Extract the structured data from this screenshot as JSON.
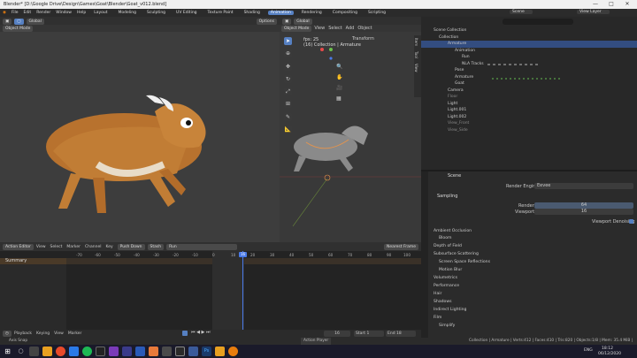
{
  "window": {
    "title": "Blender* [D:\\Google Drive\\Design\\Games\\Goat\\Blender\\Goat_v012.blend]"
  },
  "menu": [
    "File",
    "Edit",
    "Render",
    "Window",
    "Help"
  ],
  "workspaces": [
    "Layout",
    "Modeling",
    "Sculpting",
    "UV Editing",
    "Texture Paint",
    "Shading",
    "Animation",
    "Rendering",
    "Compositing",
    "Scripting"
  ],
  "active_workspace": "Animation",
  "scene": "Scene",
  "view_layer": "View Layer",
  "viewport_left": {
    "mode": "Object Mode",
    "transform": "Global",
    "options": "Options"
  },
  "viewport_cam": {
    "mode": "Object Mode",
    "menus": [
      "View",
      "Select",
      "Add",
      "Object"
    ],
    "transform": "Global",
    "fps": "fps: 25",
    "context": "(16) Collection | Armature",
    "panel": "Transform",
    "tabs": [
      "Item",
      "Tool",
      "View"
    ]
  },
  "outliner": {
    "items": [
      "Scene Collection",
      "Collection",
      "Armature",
      "Animation",
      "Run",
      "NLA Tracks",
      "Pose",
      "Armature",
      "Goat",
      "Camera",
      "Floor",
      "Light",
      "Light.001",
      "Light.002",
      "View_Front",
      "View_Side"
    ]
  },
  "properties": {
    "context": "Scene",
    "render_engine_label": "Render Engine",
    "render_engine": "Eevee",
    "sampling": "Sampling",
    "render_label": "Render",
    "render_value": "64",
    "viewport_label": "Viewport",
    "viewport_value": "16",
    "denoise": "Viewport Denoising",
    "sections": [
      "Ambient Occlusion",
      "Bloom",
      "Depth of Field",
      "Subsurface Scattering",
      "Screen Space Reflections",
      "Motion Blur",
      "Volumetrics",
      "Performance",
      "Hair",
      "Shadows",
      "Indirect Lighting",
      "Film",
      "Simplify"
    ]
  },
  "dopesheet": {
    "editor": "Action Editor",
    "menus": [
      "View",
      "Select",
      "Marker",
      "Channel",
      "Key"
    ],
    "push_down": "Push Down",
    "stash": "Stash",
    "action": "Run",
    "snap": "Nearest Frame",
    "summary": "Summary",
    "ticks": [
      "-70",
      "-60",
      "-50",
      "-40",
      "-30",
      "-20",
      "-10",
      "0",
      "10",
      "20",
      "30",
      "40",
      "50",
      "60",
      "70",
      "80",
      "90",
      "100"
    ],
    "current_frame": "16"
  },
  "playback": {
    "menus": [
      "Playback",
      "Keying",
      "View",
      "Marker"
    ],
    "frame": "16",
    "start_label": "Start",
    "start": "1",
    "end_label": "End",
    "end": "18",
    "tooltip": "Auto Keying"
  },
  "status": {
    "left": "Axis Snap",
    "mid": "Action Player",
    "right": "Collection | Armature | Verts:412 | Faces:410 | Tris:820 | Objects:1/8 | Mem: 35.4 MiB | 2.83.6"
  },
  "taskbar": {
    "lang": "ENG",
    "time": "18:12",
    "date": "06/12/2020"
  }
}
